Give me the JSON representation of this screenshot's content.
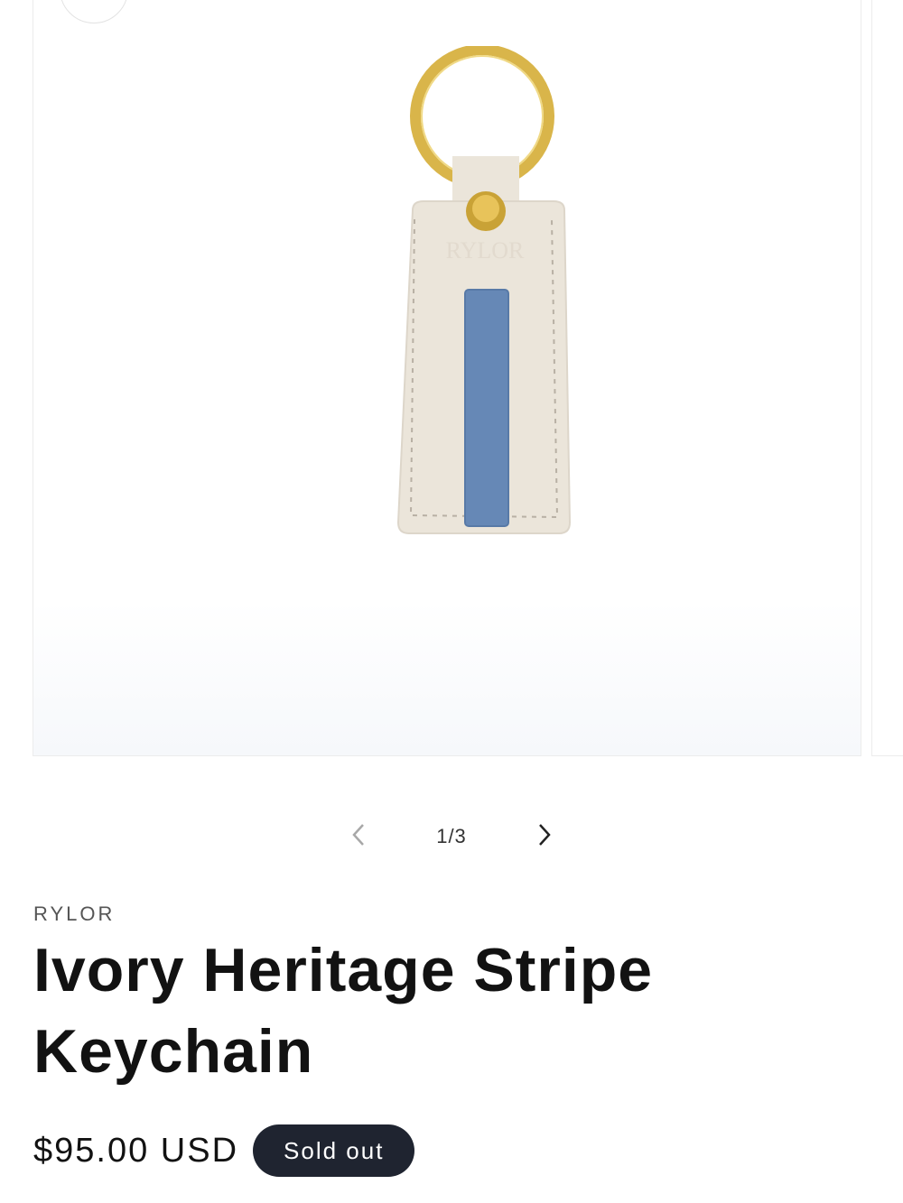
{
  "gallery": {
    "counter": "1/3",
    "image_alt": "Ivory Heritage Stripe Keychain",
    "image_brand_emboss": "RYLOR",
    "colors": {
      "leather": "#ebe5da",
      "stripe": "#6688b6",
      "ring": "#d9b54a"
    }
  },
  "product": {
    "vendor": "RYLOR",
    "title": "Ivory Heritage Stripe Keychain",
    "price": "$95.00 USD",
    "badge": "Sold out"
  },
  "colors": {
    "badge_bg": "#1f2430",
    "text": "#121212"
  },
  "icons": [
    "zoom-icon",
    "chevron-left-icon",
    "chevron-right-icon"
  ]
}
